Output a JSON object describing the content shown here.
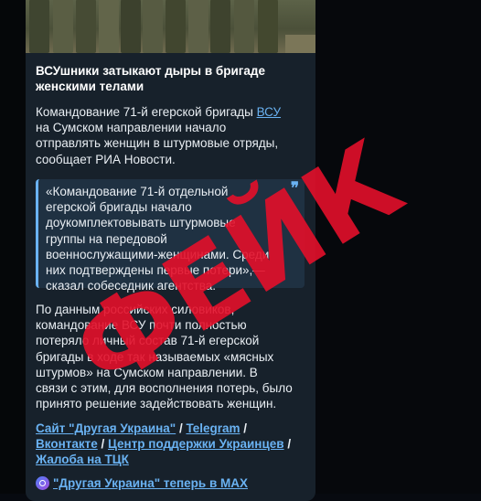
{
  "post": {
    "title_line1": "ВСУшники затыкают дыры в бригаде",
    "title_line2": "женскими телами",
    "p1": {
      "line1_pre": "Командование 71-й егерской бригады ",
      "line1_link": "ВСУ",
      "line2": "на Сумском направлении начало",
      "line3": "отправлять женщин в штурмовые отряды,",
      "line4": "сообщает РИА Новости."
    },
    "quote": {
      "mark": "❞",
      "lines": [
        "«Командование 71-й отдельной",
        "егерской бригады начало",
        "доукомплектовывать штурмовые",
        "группы на передовой",
        "военнослужащими-женщинами. Среди",
        "них подтверждены первые потери»,—",
        "сказал собеседник агентства."
      ]
    },
    "p2": {
      "lines": [
        "По данным российских силовиков,",
        "командование ВСУ почти полностью",
        "потеряло личный состав 71-й егерской",
        "бригады в ходе так называемых «мясных",
        "штурмов» на Сумском направлении. В",
        "связи с этим, для восполнения потерь, было",
        "принято решение задействовать женщин."
      ]
    },
    "links": {
      "site": "Сайт \"Другая Украина\"",
      "telegram": "Telegram",
      "vk": "Вконтакте",
      "support": "Центр поддержки Украинцев",
      "complaint": "Жалоба на ТЦК",
      "sep": " / ",
      "sep_end": " /",
      "max": "\"Другая Украина\" теперь в MAX"
    }
  },
  "overlay": {
    "stamp": "ФЕЙК",
    "color": "#e3102a"
  },
  "colors": {
    "bubble": "#17212b",
    "link": "#6ab2f2",
    "quote_bg": "#1f3142"
  }
}
